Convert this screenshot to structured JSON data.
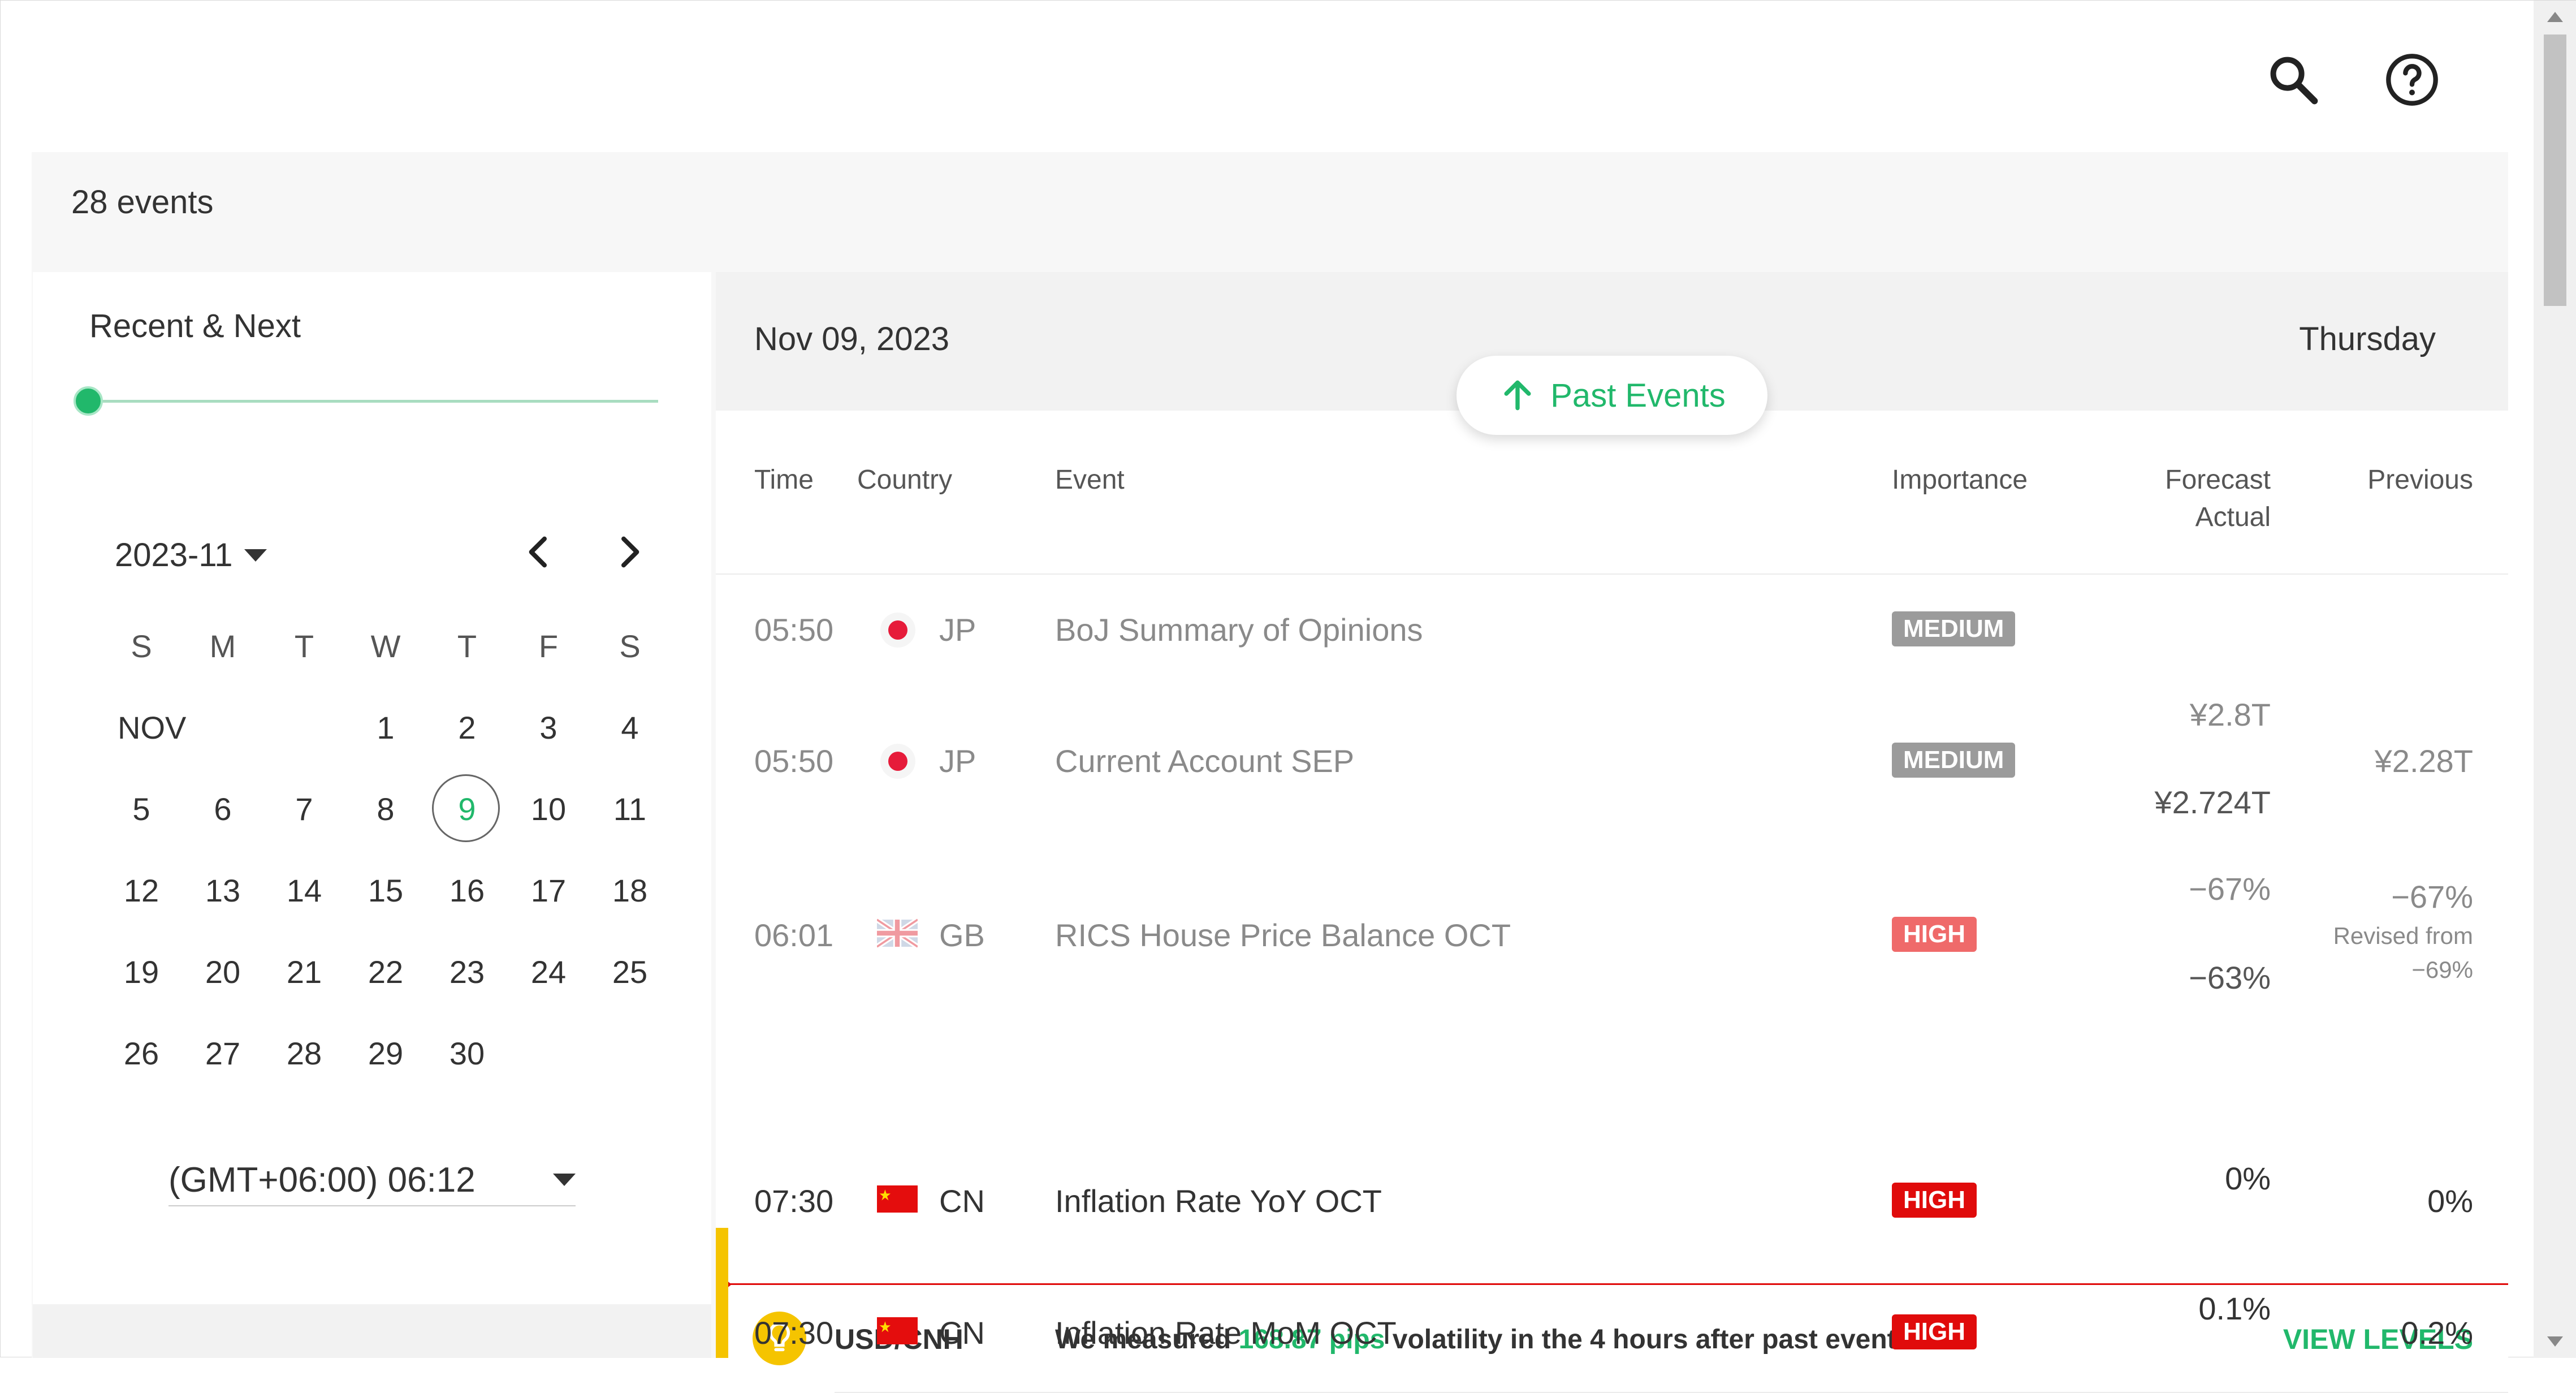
{
  "header": {
    "search_icon": "search-icon",
    "help_icon": "help-icon"
  },
  "summary": {
    "event_count": "28 events"
  },
  "filter": {
    "range_label": "Recent & Next"
  },
  "calendar": {
    "month_select": "2023-11",
    "weekdays": [
      "S",
      "M",
      "T",
      "W",
      "T",
      "F",
      "S"
    ],
    "month_label": "NOV",
    "selected_day": "9",
    "weeks": [
      [
        "",
        "",
        "",
        "1",
        "2",
        "3",
        "4"
      ],
      [
        "5",
        "6",
        "7",
        "8",
        "9",
        "10",
        "11"
      ],
      [
        "12",
        "13",
        "14",
        "15",
        "16",
        "17",
        "18"
      ],
      [
        "19",
        "20",
        "21",
        "22",
        "23",
        "24",
        "25"
      ],
      [
        "26",
        "27",
        "28",
        "29",
        "30",
        "",
        ""
      ]
    ],
    "timezone": "(GMT+06:00) 06:12"
  },
  "day_header": {
    "date": "Nov 09, 2023",
    "weekday": "Thursday"
  },
  "past_events_button": "Past Events",
  "columns": {
    "time": "Time",
    "country": "Country",
    "event": "Event",
    "importance": "Importance",
    "forecast": "Forecast",
    "actual": "Actual",
    "previous": "Previous"
  },
  "events": [
    {
      "time": "05:50",
      "country": "JP",
      "event": "BoJ Summary of Opinions",
      "importance": "MEDIUM",
      "forecast": "",
      "actual": "",
      "previous": ""
    },
    {
      "time": "05:50",
      "country": "JP",
      "event": "Current Account SEP",
      "importance": "MEDIUM",
      "forecast": "¥2.8T",
      "actual": "¥2.724T",
      "previous": "¥2.28T"
    },
    {
      "time": "06:01",
      "country": "GB",
      "event": "RICS House Price Balance OCT",
      "importance": "HIGH",
      "forecast": "−67%",
      "actual": "−63%",
      "previous": "−67%",
      "revised_label": "Revised from",
      "revised_value": "−69%"
    },
    {
      "time": "07:30",
      "country": "CN",
      "event": "Inflation Rate YoY OCT",
      "importance": "HIGH",
      "forecast": "0%",
      "actual": "",
      "previous": "0%"
    },
    {
      "time": "07:30",
      "country": "CN",
      "event": "Inflation Rate MoM OCT",
      "importance": "HIGH",
      "forecast": "0.1%",
      "actual": "",
      "previous": "0.2%"
    }
  ],
  "insight": {
    "pair": "USD/CNH",
    "text_before": "We measured ",
    "pips": "168.87 pips",
    "text_after": " volatility in the 4 hours after past events.",
    "action": "VIEW LEVELS"
  },
  "colors": {
    "accent": "#21b86b",
    "high": "#e00b0b",
    "medium": "#9b9b9b",
    "insight": "#f5c400"
  }
}
